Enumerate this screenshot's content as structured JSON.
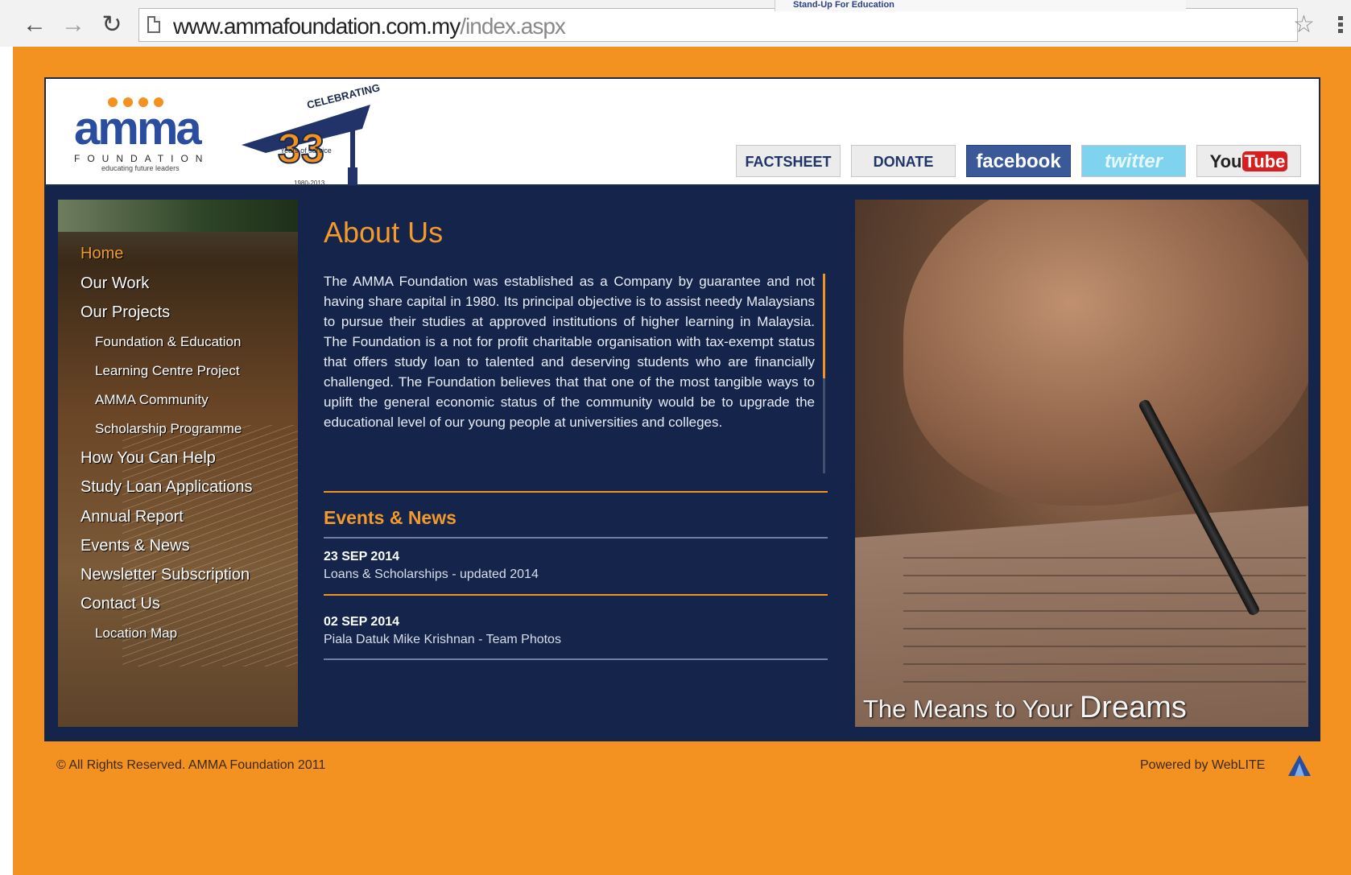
{
  "browser": {
    "url_domain": "www.ammafoundation.com.my",
    "url_path": "/index.aspx",
    "bookmark_label": "Stand-Up For Education"
  },
  "logo": {
    "word": "amma",
    "subtitle": "FOUNDATION",
    "tagline": "educating future leaders"
  },
  "anniversary": {
    "label": "CELEBRATING",
    "number": "33",
    "years_label": "Years of service",
    "range": "1980-2013"
  },
  "top_buttons": {
    "factsheet": "FACTSHEET",
    "donate": "DONATE",
    "facebook": "facebook",
    "twitter": "twitter",
    "youtube_you": "You",
    "youtube_tube": "Tube"
  },
  "sidebar": {
    "items": [
      {
        "label": "Home"
      },
      {
        "label": "Our Work"
      },
      {
        "label": "Our Projects"
      },
      {
        "label": "Foundation & Education"
      },
      {
        "label": "Learning Centre Project"
      },
      {
        "label": "AMMA Community"
      },
      {
        "label": "Scholarship Programme"
      },
      {
        "label": "How You Can Help"
      },
      {
        "label": "Study Loan Applications"
      },
      {
        "label": "Annual Report"
      },
      {
        "label": "Events & News"
      },
      {
        "label": "Newsletter Subscription"
      },
      {
        "label": "Contact Us"
      },
      {
        "label": "Location Map"
      }
    ]
  },
  "about": {
    "title": "About Us",
    "body": "The AMMA Foundation was established as a Company by guarantee and not having share capital in 1980. Its principal objective is to assist needy Malaysians to pursue their studies at approved institutions of higher learning in Malaysia. The Foundation is a not for profit charitable organisation with tax-exempt status that offers study loan to talented and deserving students who are financially challenged. The Foundation believes that that one of the most tangible ways to uplift the general economic status of the community would be to upgrade the educational level of our young people at universities and colleges."
  },
  "events": {
    "title": "Events & News",
    "items": [
      {
        "date": "23 SEP 2014",
        "title": "Loans & Scholarships - updated 2014"
      },
      {
        "date": "02 SEP 2014",
        "title": "Piala Datuk Mike Krishnan - Team Photos"
      }
    ]
  },
  "hero": {
    "caption": "The Means to Your",
    "caption_emphasis": "Dreams"
  },
  "footer": {
    "copyright": "© All Rights Reserved. AMMA Foundation 2011",
    "powered_by": "Powered by WebLITE"
  },
  "colors": {
    "orange": "#f39220",
    "navy": "#14244a",
    "logo_blue": "#2a4da0"
  }
}
